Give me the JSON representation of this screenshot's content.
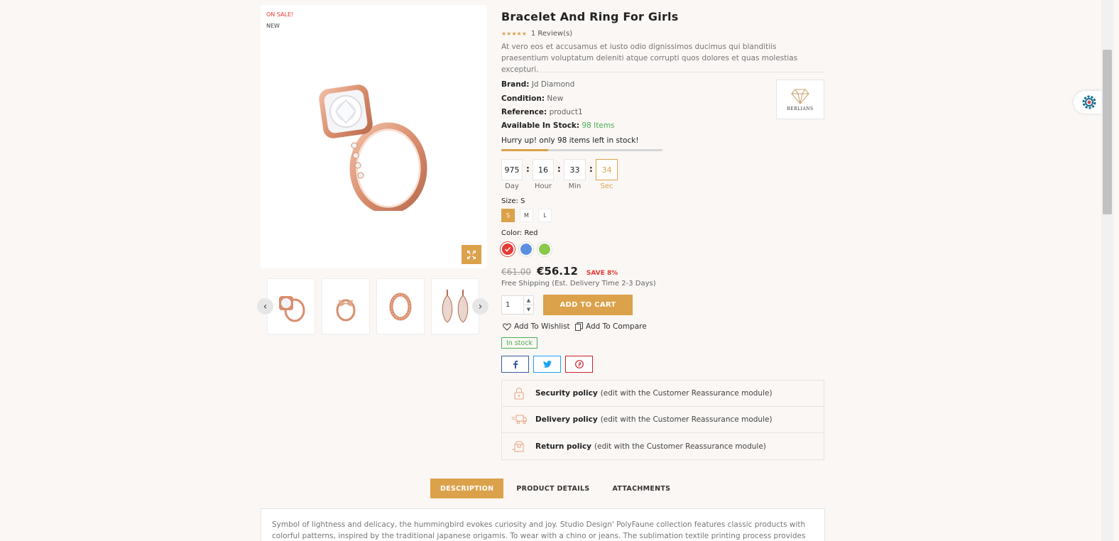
{
  "gallery": {
    "flag_sale": "ON SALE!",
    "flag_new": "NEW",
    "zoom_icon": "expand-icon",
    "thumb_count": 4
  },
  "product": {
    "title": "Bracelet And Ring For Girls",
    "rating_stars": "★★★★★",
    "rating_value": 5,
    "reviews": "1 Review(s)",
    "description": "At vero eos et accusamus et iusto odio dignissimos ducimus qui blanditiis praesentium voluptatum deleniti atque corrupti quos dolores et quas molestias excepturi.",
    "brand_label": "Brand:",
    "brand_value": "Jd Diamond",
    "condition_label": "Condition:",
    "condition_value": "New",
    "reference_label": "Reference:",
    "reference_value": "product1",
    "stock_label": "Available In Stock:",
    "stock_value": "98 Items",
    "brand_logo_text": "BERLIANS",
    "hurry_text": "Hurry up! only 98 items left in stock!",
    "stock_progress_percent": 29
  },
  "countdown": {
    "day": "975",
    "day_label": "Day",
    "hour": "16",
    "hour_label": "Hour",
    "min": "33",
    "min_label": "Min",
    "sec": "34",
    "sec_label": "Sec",
    "sep": ":"
  },
  "size": {
    "label": "Size: S",
    "options": [
      "S",
      "M",
      "L"
    ],
    "selected": "S"
  },
  "color": {
    "label": "Color: Red",
    "swatches": [
      "#e53935",
      "#5b8fe0",
      "#8cc84b"
    ],
    "selected": "#e53935"
  },
  "pricing": {
    "old_price": "€61.00",
    "price": "€56.12",
    "save": "SAVE 8%",
    "shipping": "Free Shipping (Est. Delivery Time 2-3 Days)"
  },
  "cart": {
    "quantity": "1",
    "add_to_cart": "ADD TO CART",
    "wishlist": "Add To Wishlist",
    "compare": "Add To Compare",
    "in_stock": "In stock"
  },
  "share": {
    "facebook_color": "#3b5998",
    "twitter_color": "#1da1f2",
    "pinterest_color": "#cb2027"
  },
  "reassurance": [
    {
      "title": "Security policy",
      "text": "(edit with the Customer Reassurance module)",
      "icon": "lock-icon"
    },
    {
      "title": "Delivery policy",
      "text": "(edit with the Customer Reassurance module)",
      "icon": "truck-icon"
    },
    {
      "title": "Return policy",
      "text": "(edit with the Customer Reassurance module)",
      "icon": "return-box-icon"
    }
  ],
  "tabs": {
    "description": "DESCRIPTION",
    "product_details": "PRODUCT DETAILS",
    "attachments": "ATTACHMENTS",
    "active": "DESCRIPTION",
    "content": "Symbol of lightness and delicacy, the hummingbird evokes curiosity and joy. Studio Design' PolyFaune collection features classic products with colorful patterns, inspired by the traditional japanese origamis. To wear with a chino or jeans. The sublimation textile printing process provides an exceptional"
  },
  "colors": {
    "accent": "#dca14b",
    "sale_red": "#e53935",
    "stock_green": "#4caf50",
    "background": "#faf7f5"
  }
}
